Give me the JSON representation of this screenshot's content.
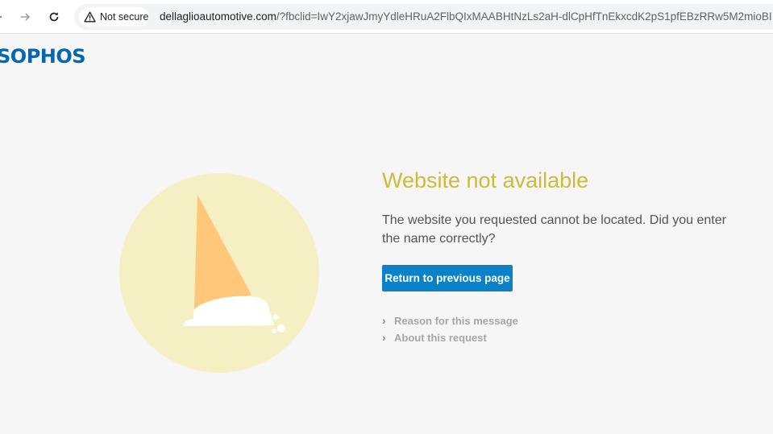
{
  "browser": {
    "security_label": "Not secure",
    "url_domain": "dellaglioautomotive.com",
    "url_path": "/?fbclid=IwY2xjawJmyYdleHRuA2FlbQIxMAABHtNzLs2aH-dlCpHfTnEkxcdK2pS1pfEBzRRw5M2mioBI",
    "icons": {
      "back": "back-arrow-icon",
      "forward": "forward-arrow-icon",
      "reload": "reload-icon",
      "warning": "warning-triangle-icon"
    }
  },
  "brand": {
    "logo_text": "SOPHOS",
    "color": "#0068b4"
  },
  "error": {
    "title": "Website not available",
    "message": "The website you requested cannot be located. Did you enter the name correctly?",
    "return_button_label": "Return to previous page",
    "links": {
      "reason": "Reason for this message",
      "about": "About this request"
    }
  },
  "colors": {
    "title": "#cdbb3a",
    "button": "#0b82c8",
    "illustration_circle": "#f5f0c4",
    "cone": "#fec77a"
  }
}
